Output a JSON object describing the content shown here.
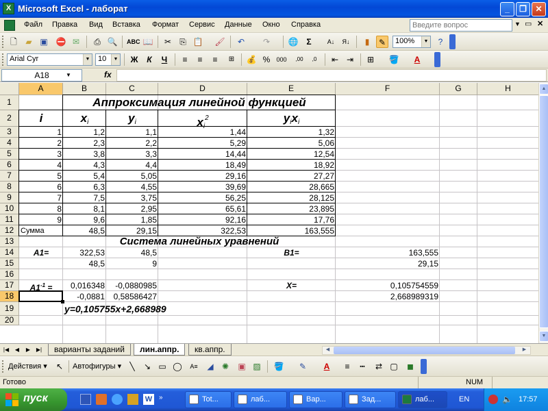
{
  "window": {
    "title": "Microsoft Excel - лаборат",
    "app_icon": "excel-icon",
    "controls": [
      "minimize",
      "restore",
      "close"
    ]
  },
  "menu": {
    "items": [
      "Файл",
      "Правка",
      "Вид",
      "Вставка",
      "Формат",
      "Сервис",
      "Данные",
      "Окно",
      "Справка"
    ],
    "help_placeholder": "Введите вопрос"
  },
  "toolbar_standard": {
    "zoom": "100%"
  },
  "toolbar_formatting": {
    "font": "Arial Cyr",
    "size": "10",
    "bold": "Ж",
    "italic": "К",
    "underline": "Ч"
  },
  "formula_bar": {
    "name_box": "A18",
    "fx": "fx",
    "formula": ""
  },
  "grid": {
    "columns": [
      "A",
      "B",
      "C",
      "D",
      "E",
      "F",
      "G",
      "H"
    ],
    "rows": [
      "1",
      "2",
      "3",
      "4",
      "5",
      "6",
      "7",
      "8",
      "9",
      "10",
      "11",
      "12",
      "13",
      "14",
      "15",
      "16",
      "17",
      "18",
      "19",
      "20"
    ],
    "selected_column": "A",
    "selected_row": "18"
  },
  "sheet": {
    "title": "Аппроксимация линейной функцией",
    "headers": {
      "i": "i",
      "x": "x",
      "x_sub": "i",
      "y": "y",
      "y_sub": "i",
      "x2": "x",
      "x2_sub": "i",
      "x2_sup": "2",
      "yx_y": "y",
      "yx_ysub": "i",
      "yx_x": "x",
      "yx_xsub": "i"
    },
    "data": [
      {
        "i": "1",
        "x": "1,2",
        "y": "1,1",
        "x2": "1,44",
        "yx": "1,32"
      },
      {
        "i": "2",
        "x": "2,3",
        "y": "2,2",
        "x2": "5,29",
        "yx": "5,06"
      },
      {
        "i": "3",
        "x": "3,8",
        "y": "3,3",
        "x2": "14,44",
        "yx": "12,54"
      },
      {
        "i": "4",
        "x": "4,3",
        "y": "4,4",
        "x2": "18,49",
        "yx": "18,92"
      },
      {
        "i": "5",
        "x": "5,4",
        "y": "5,05",
        "x2": "29,16",
        "yx": "27,27"
      },
      {
        "i": "6",
        "x": "6,3",
        "y": "4,55",
        "x2": "39,69",
        "yx": "28,665"
      },
      {
        "i": "7",
        "x": "7,5",
        "y": "3,75",
        "x2": "56,25",
        "yx": "28,125"
      },
      {
        "i": "8",
        "x": "8,1",
        "y": "2,95",
        "x2": "65,61",
        "yx": "23,895"
      },
      {
        "i": "9",
        "x": "9,6",
        "y": "1,85",
        "x2": "92,16",
        "yx": "17,76"
      }
    ],
    "sum": {
      "label": "Сумма",
      "x": "48,5",
      "y": "29,15",
      "x2": "322,53",
      "yx": "163,555"
    },
    "system_title": "Система линейных уравнений",
    "a1_label": "A1=",
    "a1": [
      [
        "322,53",
        "48,5"
      ],
      [
        "48,5",
        "9"
      ]
    ],
    "b1_label": "B1=",
    "b1": [
      "163,555",
      "29,15"
    ],
    "a1inv_label": "A1",
    "a1inv_sup": "-1",
    "a1inv_eq": " =",
    "a1inv": [
      [
        "0,016348",
        "-0,0880985"
      ],
      [
        "-0,0881",
        "0,58586427"
      ]
    ],
    "x_label": "X=",
    "x": [
      "0,105754559",
      "2,668989319"
    ],
    "equation": "y=0,105755x+2,668989"
  },
  "sheet_tabs": {
    "tabs": [
      "варианты заданий",
      "лин.аппр.",
      "кв.аппр."
    ],
    "active": "лин.аппр."
  },
  "drawing_toolbar": {
    "actions": "Действия",
    "autoshapes": "Автофигуры"
  },
  "status_bar": {
    "status": "Готово",
    "num": "NUM"
  },
  "taskbar": {
    "start": "пуск",
    "buttons": [
      "Tot...",
      "лаб...",
      "Вар...",
      "Зад...",
      "лаб..."
    ],
    "active_index": 4,
    "lang": "EN",
    "time": "17:57"
  },
  "colors": {
    "titlebar": "#0348d6",
    "selected_header": "#f9c86b",
    "taskbar": "#245edb",
    "start_button": "#37962f"
  }
}
